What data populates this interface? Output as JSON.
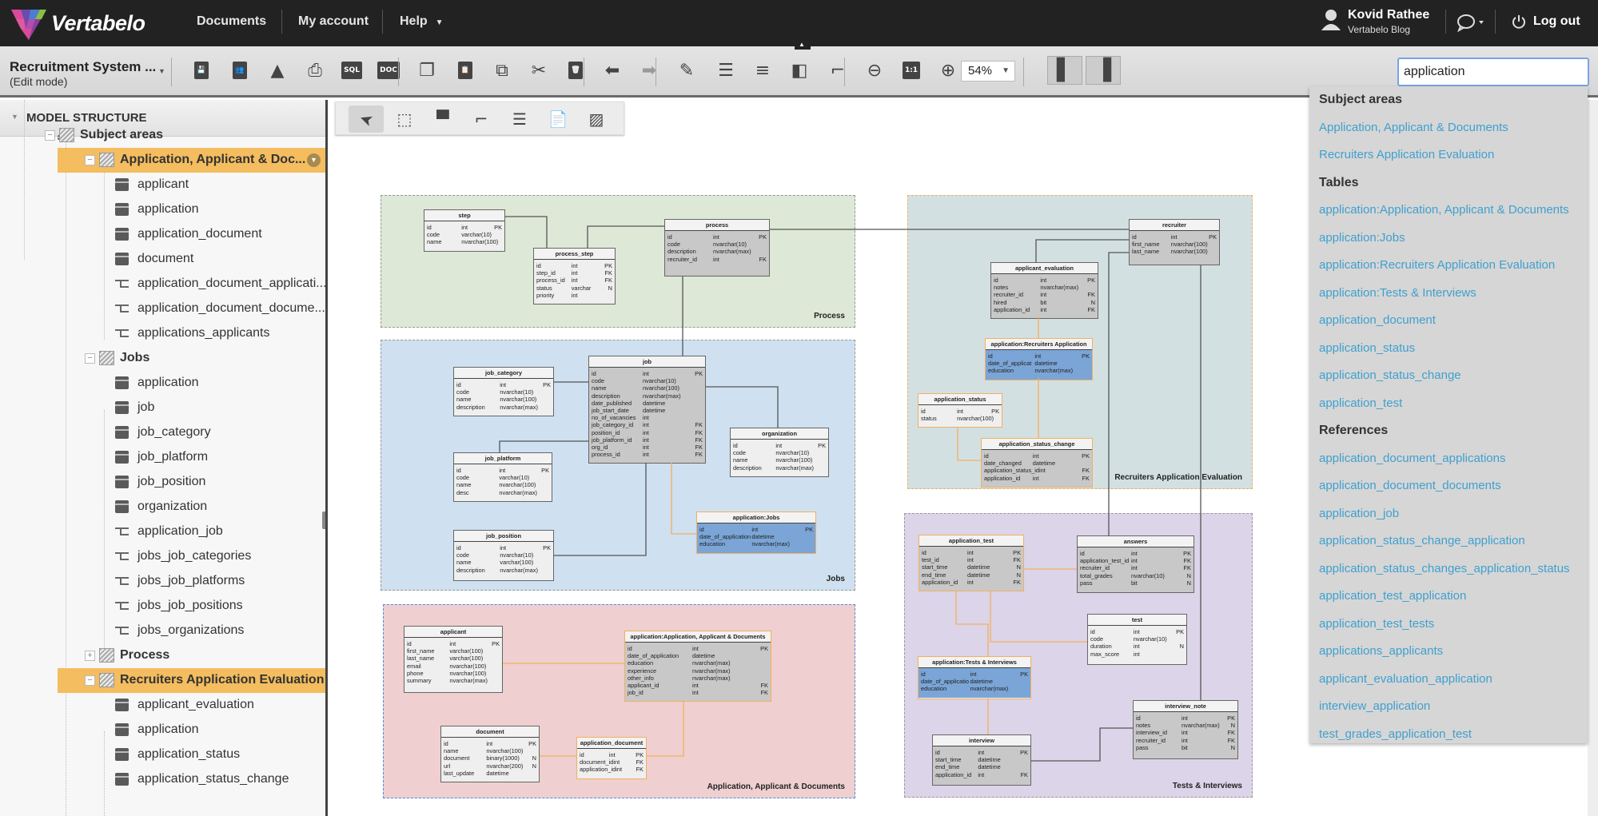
{
  "app": {
    "brand": "Vertabelo",
    "nav": [
      "Documents",
      "My account",
      "Help"
    ],
    "user_name": "Kovid Rathee",
    "user_sub": "Vertabelo Blog",
    "logout": "Log out"
  },
  "toolbar": {
    "doc_title": "Recruitment System ...",
    "doc_mode": "(Edit mode)",
    "zoom": "54%",
    "icons": [
      "save-icon",
      "share-icon",
      "export-image-icon",
      "print-icon",
      "sql-icon",
      "doc-icon",
      "copy-icon",
      "paste-icon",
      "duplicate-icon",
      "cut-icon",
      "delete-icon",
      "undo-icon",
      "redo-icon",
      "edit-style-icon",
      "align-icon",
      "distribute-icon",
      "arrange-icon",
      "line-style-icon",
      "zoom-out-icon",
      "actual-size-icon",
      "zoom-in-icon",
      "left-panel-icon",
      "right-panel-icon"
    ]
  },
  "search": {
    "value": "application"
  },
  "sidebar": {
    "title": "MODEL STRUCTURE",
    "rows": [
      {
        "type": "group",
        "label": "Subject areas",
        "level": 0,
        "toggle": "−"
      },
      {
        "type": "group",
        "label": "Application, Applicant & Doc...",
        "level": 1,
        "toggle": "−",
        "selected": true
      },
      {
        "type": "table",
        "label": "applicant"
      },
      {
        "type": "table",
        "label": "application"
      },
      {
        "type": "table",
        "label": "application_document"
      },
      {
        "type": "table",
        "label": "document"
      },
      {
        "type": "ref",
        "label": "application_document_applicati..."
      },
      {
        "type": "ref",
        "label": "application_document_docume..."
      },
      {
        "type": "ref",
        "label": "applications_applicants"
      },
      {
        "type": "group",
        "label": "Jobs",
        "level": 1,
        "toggle": "−"
      },
      {
        "type": "table",
        "label": "application"
      },
      {
        "type": "table",
        "label": "job"
      },
      {
        "type": "table",
        "label": "job_category"
      },
      {
        "type": "table",
        "label": "job_platform"
      },
      {
        "type": "table",
        "label": "job_position"
      },
      {
        "type": "table",
        "label": "organization"
      },
      {
        "type": "ref",
        "label": "application_job"
      },
      {
        "type": "ref",
        "label": "jobs_job_categories"
      },
      {
        "type": "ref",
        "label": "jobs_job_platforms"
      },
      {
        "type": "ref",
        "label": "jobs_job_positions"
      },
      {
        "type": "ref",
        "label": "jobs_organizations"
      },
      {
        "type": "group",
        "label": "Process",
        "level": 1,
        "toggle": "+"
      },
      {
        "type": "group",
        "label": "Recruiters Application Evaluation",
        "level": 1,
        "toggle": "−",
        "selected": true
      },
      {
        "type": "table",
        "label": "applicant_evaluation"
      },
      {
        "type": "table",
        "label": "application"
      },
      {
        "type": "table",
        "label": "application_status"
      },
      {
        "type": "table",
        "label": "application_status_change"
      }
    ]
  },
  "palette": [
    "select-icon",
    "area-select-icon",
    "table-icon",
    "reference-icon",
    "view-icon",
    "note-icon",
    "subject-area-icon"
  ],
  "dropdown": {
    "sections": [
      {
        "title": "Subject areas",
        "items": [
          "Application, Applicant & Documents",
          "Recruiters Application Evaluation"
        ]
      },
      {
        "title": "Tables",
        "items": [
          "application:Application, Applicant & Documents",
          "application:Jobs",
          "application:Recruiters Application Evaluation",
          "application:Tests & Interviews",
          "application_document",
          "application_status",
          "application_status_change",
          "application_test"
        ]
      },
      {
        "title": "References",
        "items": [
          "application_document_applications",
          "application_document_documents",
          "application_job",
          "application_status_change_application",
          "application_status_changes_application_status",
          "application_test_application",
          "application_test_tests",
          "applications_applicants",
          "applicant_evaluation_application",
          "interview_application",
          "test_grades_application_test"
        ]
      }
    ]
  },
  "diagram": {
    "areas": [
      {
        "name": "Process",
        "color": "#dde8d6"
      },
      {
        "name": "Jobs",
        "color": "#cfe0f0"
      },
      {
        "name": "Application, Applicant & Documents",
        "color": "#efcfcf"
      },
      {
        "name": "Recruiters Application Evaluation",
        "color": "#d3e0e2"
      },
      {
        "name": "Tests & Interviews",
        "color": "#dcd4e8"
      }
    ],
    "tables": [
      {
        "name": "step",
        "cols": [
          [
            "id",
            "int",
            "PK"
          ],
          [
            "code",
            "varchar(10)",
            ""
          ],
          [
            "name",
            "nvarchar(100)",
            ""
          ]
        ]
      },
      {
        "name": "process_step",
        "cols": [
          [
            "id",
            "int",
            "PK"
          ],
          [
            "step_id",
            "int",
            "FK"
          ],
          [
            "process_id",
            "int",
            "FK"
          ],
          [
            "status",
            "varchar",
            "N"
          ],
          [
            "priority",
            "int",
            ""
          ]
        ]
      },
      {
        "name": "process",
        "cols": [
          [
            "id",
            "int",
            "PK"
          ],
          [
            "code",
            "nvarchar(10)",
            ""
          ],
          [
            "description",
            "nvarchar(max)",
            ""
          ],
          [
            "recruiter_id",
            "int",
            "FK"
          ]
        ]
      },
      {
        "name": "job_category",
        "cols": [
          [
            "id",
            "int",
            "PK"
          ],
          [
            "code",
            "nvarchar(10)",
            ""
          ],
          [
            "name",
            "nvarchar(100)",
            ""
          ],
          [
            "description",
            "nvarchar(max)",
            ""
          ]
        ]
      },
      {
        "name": "job",
        "cols": [
          [
            "id",
            "int",
            "PK"
          ],
          [
            "code",
            "nvarchar(10)",
            ""
          ],
          [
            "name",
            "nvarchar(100)",
            ""
          ],
          [
            "description",
            "nvarchar(max)",
            ""
          ],
          [
            "date_published",
            "datetime",
            ""
          ],
          [
            "job_start_date",
            "datetime",
            ""
          ],
          [
            "no_of_vacancies",
            "int",
            ""
          ],
          [
            "job_category_id",
            "int",
            "FK"
          ],
          [
            "position_id",
            "int",
            "FK"
          ],
          [
            "job_platform_id",
            "int",
            "FK"
          ],
          [
            "org_id",
            "int",
            "FK"
          ],
          [
            "process_id",
            "int",
            "FK"
          ]
        ]
      },
      {
        "name": "organization",
        "cols": [
          [
            "id",
            "int",
            "PK"
          ],
          [
            "code",
            "nvarchar(10)",
            ""
          ],
          [
            "name",
            "nvarchar(100)",
            ""
          ],
          [
            "description",
            "nvarchar(max)",
            ""
          ]
        ]
      },
      {
        "name": "job_platform",
        "cols": [
          [
            "id",
            "int",
            "PK"
          ],
          [
            "code",
            "varchar(10)",
            ""
          ],
          [
            "name",
            "nvarchar(100)",
            ""
          ],
          [
            "desc",
            "nvarchar(max)",
            ""
          ]
        ]
      },
      {
        "name": "application:Jobs",
        "cols": [
          [
            "id",
            "int",
            "PK"
          ],
          [
            "date_of_application",
            "datetime",
            ""
          ],
          [
            "education",
            "nvarchar(max)",
            ""
          ]
        ]
      },
      {
        "name": "job_position",
        "cols": [
          [
            "id",
            "int",
            "PK"
          ],
          [
            "code",
            "nvarchar(10)",
            ""
          ],
          [
            "name",
            "varchar(100)",
            ""
          ],
          [
            "description",
            "nvarchar(max)",
            ""
          ]
        ]
      },
      {
        "name": "applicant",
        "cols": [
          [
            "id",
            "int",
            "PK"
          ],
          [
            "first_name",
            "varchar(100)",
            ""
          ],
          [
            "last_name",
            "varchar(100)",
            ""
          ],
          [
            "email",
            "nvarchar(100)",
            ""
          ],
          [
            "phone",
            "nvarchar(100)",
            ""
          ],
          [
            "summary",
            "nvarchar(max)",
            ""
          ]
        ]
      },
      {
        "name": "application:Application, Applicant & Documents",
        "cols": [
          [
            "id",
            "int",
            "PK"
          ],
          [
            "date_of_application",
            "datetime",
            ""
          ],
          [
            "education",
            "nvarchar(max)",
            ""
          ],
          [
            "experience",
            "nvarchar(max)",
            ""
          ],
          [
            "other_info",
            "nvarchar(max)",
            ""
          ],
          [
            "applicant_id",
            "int",
            "FK"
          ],
          [
            "job_id",
            "int",
            "FK"
          ]
        ]
      },
      {
        "name": "document",
        "cols": [
          [
            "id",
            "int",
            "PK"
          ],
          [
            "name",
            "nvarchar(100)",
            ""
          ],
          [
            "document",
            "binary(1000)",
            "N"
          ],
          [
            "url",
            "nvarchar(200)",
            "N"
          ],
          [
            "last_update",
            "datetime",
            ""
          ]
        ]
      },
      {
        "name": "application_document",
        "cols": [
          [
            "id",
            "int",
            "PK"
          ],
          [
            "document_id",
            "int",
            "FK"
          ],
          [
            "application_id",
            "int",
            "FK"
          ]
        ]
      },
      {
        "name": "recruiter",
        "cols": [
          [
            "id",
            "int",
            "PK"
          ],
          [
            "first_name",
            "nvarchar(100)",
            ""
          ],
          [
            "last_name",
            "nvarchar(100)",
            ""
          ]
        ]
      },
      {
        "name": "applicant_evaluation",
        "cols": [
          [
            "id",
            "int",
            "PK"
          ],
          [
            "notes",
            "nvarchar(max)",
            ""
          ],
          [
            "recruiter_id",
            "int",
            "FK"
          ],
          [
            "hired",
            "bit",
            "N"
          ],
          [
            "application_id",
            "int",
            "FK"
          ]
        ]
      },
      {
        "name": "application:Recruiters Application",
        "cols": [
          [
            "id",
            "int",
            "PK"
          ],
          [
            "date_of_applicat",
            "datetime",
            ""
          ],
          [
            "education",
            "nvarchar(max)",
            ""
          ]
        ]
      },
      {
        "name": "application_status",
        "cols": [
          [
            "id",
            "int",
            "PK"
          ],
          [
            "status",
            "nvarchar(100)",
            ""
          ]
        ]
      },
      {
        "name": "application_status_change",
        "cols": [
          [
            "id",
            "int",
            "PK"
          ],
          [
            "date_changed",
            "datetime",
            ""
          ],
          [
            "application_status_id",
            "int",
            "FK"
          ],
          [
            "application_id",
            "int",
            "FK"
          ]
        ]
      },
      {
        "name": "application_test",
        "cols": [
          [
            "id",
            "int",
            "PK"
          ],
          [
            "test_id",
            "int",
            "FK"
          ],
          [
            "start_time",
            "datetime",
            "N"
          ],
          [
            "end_time",
            "datetime",
            "N"
          ],
          [
            "application_id",
            "int",
            "FK"
          ]
        ]
      },
      {
        "name": "answers",
        "cols": [
          [
            "id",
            "int",
            "PK"
          ],
          [
            "application_test_id",
            "int",
            "FK"
          ],
          [
            "recruiter_id",
            "int",
            "FK"
          ],
          [
            "total_grades",
            "nvarchar(10)",
            "N"
          ],
          [
            "pass",
            "bit",
            "N"
          ]
        ]
      },
      {
        "name": "test",
        "cols": [
          [
            "id",
            "int",
            "PK"
          ],
          [
            "code",
            "nvarchar(10)",
            ""
          ],
          [
            "duration",
            "int",
            "N"
          ],
          [
            "max_score",
            "int",
            ""
          ]
        ]
      },
      {
        "name": "application:Tests & Interviews",
        "cols": [
          [
            "id",
            "int",
            "PK"
          ],
          [
            "date_of_applicatio",
            "datetime",
            ""
          ],
          [
            "education",
            "nvarchar(max)",
            ""
          ]
        ]
      },
      {
        "name": "interview",
        "cols": [
          [
            "id",
            "int",
            "PK"
          ],
          [
            "start_time",
            "datetime",
            ""
          ],
          [
            "end_time",
            "datetime",
            ""
          ],
          [
            "application_id",
            "int",
            "FK"
          ]
        ]
      },
      {
        "name": "interview_note",
        "cols": [
          [
            "id",
            "int",
            "PK"
          ],
          [
            "notes",
            "nvarchar(max)",
            "N"
          ],
          [
            "interview_id",
            "int",
            "FK"
          ],
          [
            "recruiter_id",
            "int",
            "FK"
          ],
          [
            "pass",
            "bit",
            "N"
          ]
        ]
      }
    ]
  }
}
